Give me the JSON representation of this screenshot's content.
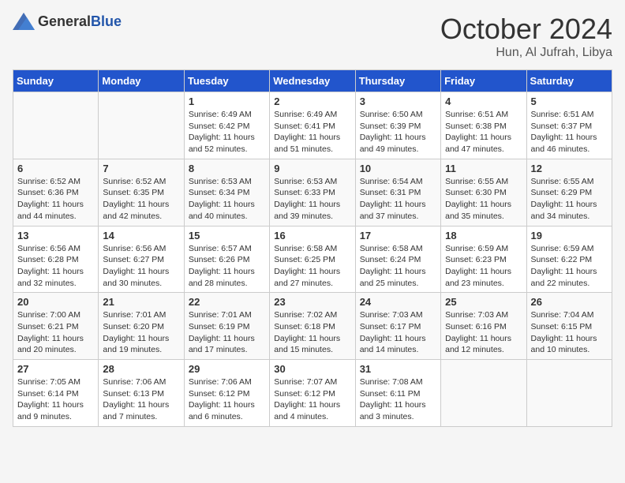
{
  "header": {
    "logo_general": "General",
    "logo_blue": "Blue",
    "month": "October 2024",
    "location": "Hun, Al Jufrah, Libya"
  },
  "days_of_week": [
    "Sunday",
    "Monday",
    "Tuesday",
    "Wednesday",
    "Thursday",
    "Friday",
    "Saturday"
  ],
  "weeks": [
    [
      {
        "day": "",
        "sunrise": "",
        "sunset": "",
        "daylight": ""
      },
      {
        "day": "",
        "sunrise": "",
        "sunset": "",
        "daylight": ""
      },
      {
        "day": "1",
        "sunrise": "Sunrise: 6:49 AM",
        "sunset": "Sunset: 6:42 PM",
        "daylight": "Daylight: 11 hours and 52 minutes."
      },
      {
        "day": "2",
        "sunrise": "Sunrise: 6:49 AM",
        "sunset": "Sunset: 6:41 PM",
        "daylight": "Daylight: 11 hours and 51 minutes."
      },
      {
        "day": "3",
        "sunrise": "Sunrise: 6:50 AM",
        "sunset": "Sunset: 6:39 PM",
        "daylight": "Daylight: 11 hours and 49 minutes."
      },
      {
        "day": "4",
        "sunrise": "Sunrise: 6:51 AM",
        "sunset": "Sunset: 6:38 PM",
        "daylight": "Daylight: 11 hours and 47 minutes."
      },
      {
        "day": "5",
        "sunrise": "Sunrise: 6:51 AM",
        "sunset": "Sunset: 6:37 PM",
        "daylight": "Daylight: 11 hours and 46 minutes."
      }
    ],
    [
      {
        "day": "6",
        "sunrise": "Sunrise: 6:52 AM",
        "sunset": "Sunset: 6:36 PM",
        "daylight": "Daylight: 11 hours and 44 minutes."
      },
      {
        "day": "7",
        "sunrise": "Sunrise: 6:52 AM",
        "sunset": "Sunset: 6:35 PM",
        "daylight": "Daylight: 11 hours and 42 minutes."
      },
      {
        "day": "8",
        "sunrise": "Sunrise: 6:53 AM",
        "sunset": "Sunset: 6:34 PM",
        "daylight": "Daylight: 11 hours and 40 minutes."
      },
      {
        "day": "9",
        "sunrise": "Sunrise: 6:53 AM",
        "sunset": "Sunset: 6:33 PM",
        "daylight": "Daylight: 11 hours and 39 minutes."
      },
      {
        "day": "10",
        "sunrise": "Sunrise: 6:54 AM",
        "sunset": "Sunset: 6:31 PM",
        "daylight": "Daylight: 11 hours and 37 minutes."
      },
      {
        "day": "11",
        "sunrise": "Sunrise: 6:55 AM",
        "sunset": "Sunset: 6:30 PM",
        "daylight": "Daylight: 11 hours and 35 minutes."
      },
      {
        "day": "12",
        "sunrise": "Sunrise: 6:55 AM",
        "sunset": "Sunset: 6:29 PM",
        "daylight": "Daylight: 11 hours and 34 minutes."
      }
    ],
    [
      {
        "day": "13",
        "sunrise": "Sunrise: 6:56 AM",
        "sunset": "Sunset: 6:28 PM",
        "daylight": "Daylight: 11 hours and 32 minutes."
      },
      {
        "day": "14",
        "sunrise": "Sunrise: 6:56 AM",
        "sunset": "Sunset: 6:27 PM",
        "daylight": "Daylight: 11 hours and 30 minutes."
      },
      {
        "day": "15",
        "sunrise": "Sunrise: 6:57 AM",
        "sunset": "Sunset: 6:26 PM",
        "daylight": "Daylight: 11 hours and 28 minutes."
      },
      {
        "day": "16",
        "sunrise": "Sunrise: 6:58 AM",
        "sunset": "Sunset: 6:25 PM",
        "daylight": "Daylight: 11 hours and 27 minutes."
      },
      {
        "day": "17",
        "sunrise": "Sunrise: 6:58 AM",
        "sunset": "Sunset: 6:24 PM",
        "daylight": "Daylight: 11 hours and 25 minutes."
      },
      {
        "day": "18",
        "sunrise": "Sunrise: 6:59 AM",
        "sunset": "Sunset: 6:23 PM",
        "daylight": "Daylight: 11 hours and 23 minutes."
      },
      {
        "day": "19",
        "sunrise": "Sunrise: 6:59 AM",
        "sunset": "Sunset: 6:22 PM",
        "daylight": "Daylight: 11 hours and 22 minutes."
      }
    ],
    [
      {
        "day": "20",
        "sunrise": "Sunrise: 7:00 AM",
        "sunset": "Sunset: 6:21 PM",
        "daylight": "Daylight: 11 hours and 20 minutes."
      },
      {
        "day": "21",
        "sunrise": "Sunrise: 7:01 AM",
        "sunset": "Sunset: 6:20 PM",
        "daylight": "Daylight: 11 hours and 19 minutes."
      },
      {
        "day": "22",
        "sunrise": "Sunrise: 7:01 AM",
        "sunset": "Sunset: 6:19 PM",
        "daylight": "Daylight: 11 hours and 17 minutes."
      },
      {
        "day": "23",
        "sunrise": "Sunrise: 7:02 AM",
        "sunset": "Sunset: 6:18 PM",
        "daylight": "Daylight: 11 hours and 15 minutes."
      },
      {
        "day": "24",
        "sunrise": "Sunrise: 7:03 AM",
        "sunset": "Sunset: 6:17 PM",
        "daylight": "Daylight: 11 hours and 14 minutes."
      },
      {
        "day": "25",
        "sunrise": "Sunrise: 7:03 AM",
        "sunset": "Sunset: 6:16 PM",
        "daylight": "Daylight: 11 hours and 12 minutes."
      },
      {
        "day": "26",
        "sunrise": "Sunrise: 7:04 AM",
        "sunset": "Sunset: 6:15 PM",
        "daylight": "Daylight: 11 hours and 10 minutes."
      }
    ],
    [
      {
        "day": "27",
        "sunrise": "Sunrise: 7:05 AM",
        "sunset": "Sunset: 6:14 PM",
        "daylight": "Daylight: 11 hours and 9 minutes."
      },
      {
        "day": "28",
        "sunrise": "Sunrise: 7:06 AM",
        "sunset": "Sunset: 6:13 PM",
        "daylight": "Daylight: 11 hours and 7 minutes."
      },
      {
        "day": "29",
        "sunrise": "Sunrise: 7:06 AM",
        "sunset": "Sunset: 6:12 PM",
        "daylight": "Daylight: 11 hours and 6 minutes."
      },
      {
        "day": "30",
        "sunrise": "Sunrise: 7:07 AM",
        "sunset": "Sunset: 6:12 PM",
        "daylight": "Daylight: 11 hours and 4 minutes."
      },
      {
        "day": "31",
        "sunrise": "Sunrise: 7:08 AM",
        "sunset": "Sunset: 6:11 PM",
        "daylight": "Daylight: 11 hours and 3 minutes."
      },
      {
        "day": "",
        "sunrise": "",
        "sunset": "",
        "daylight": ""
      },
      {
        "day": "",
        "sunrise": "",
        "sunset": "",
        "daylight": ""
      }
    ]
  ]
}
